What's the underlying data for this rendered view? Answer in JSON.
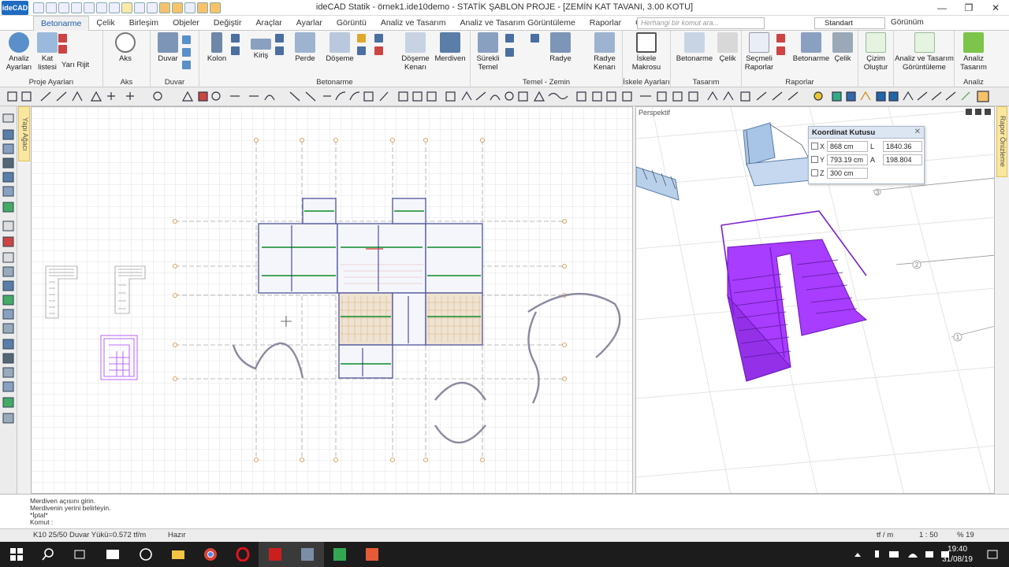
{
  "app": {
    "logo": "ideCAD",
    "title": "ideCAD Statik - örnek1.ide10demo - STATİK ŞABLON PROJE - [ZEMİN KAT TAVANI,  3.00 KOTU]",
    "window_controls": [
      "—",
      "❐",
      "✕"
    ]
  },
  "tabs": [
    "Betonarme",
    "Çelik",
    "Birleşim",
    "Objeler",
    "Değiştir",
    "Araçlar",
    "Ayarlar",
    "Görüntü",
    "Analiz ve Tasarım",
    "Analiz ve Tasarım Görüntüleme",
    "Raporlar",
    "Çizimler"
  ],
  "active_tab": "Betonarme",
  "search_placeholder": "Herhangi bir komut ara...",
  "style_select": "Standart",
  "gorunum_label": "Görünüm",
  "ribbon_groups": [
    {
      "label": "Proje Ayarları",
      "buttons": [
        "Analiz\nAyarları",
        "Kat\nlistesi",
        "Yarı Rijit"
      ]
    },
    {
      "label": "Aks",
      "buttons": [
        "Aks"
      ]
    },
    {
      "label": "Duvar",
      "buttons": [
        "Duvar"
      ]
    },
    {
      "label": "Betonarme",
      "buttons": [
        "Kolon",
        "Kiriş",
        "Perde",
        "Döşeme",
        "Döşeme\nKenarı",
        "Merdiven"
      ]
    },
    {
      "label": "Temel - Zemin",
      "buttons": [
        "Sürekli\nTemel",
        "Radye",
        "Radye\nKenarı"
      ]
    },
    {
      "label": "İskele Ayarları",
      "buttons": [
        "İskele\nMakrosu"
      ]
    },
    {
      "label": "Tasarım",
      "buttons": [
        "Betonarme",
        "Çelik"
      ]
    },
    {
      "label": "Raporlar",
      "buttons": [
        "Seçmeli\nRaporlar",
        "Betonarme",
        "Çelik"
      ]
    },
    {
      "label": "",
      "buttons": [
        "Çizim\nOluştur"
      ]
    },
    {
      "label": "",
      "buttons": [
        "Analiz ve Tasarım\nGörüntüleme"
      ]
    },
    {
      "label": "Analiz",
      "buttons": [
        "Analiz\nTasarım"
      ]
    }
  ],
  "side_tabs": {
    "left": "Yapı Ağacı",
    "right": "Rapor Önizleme"
  },
  "perspective_label": "Perspektif",
  "coord_box": {
    "title": "Koordinat Kutusu",
    "x": "868 cm",
    "y": "793.19 cm",
    "z": "300 cm",
    "l_label": "L",
    "l": "1840.36 cm",
    "a_label": "A",
    "a": "198.804"
  },
  "command_lines": [
    "Merdiven açısını girin.",
    "Merdivenin yerini belirleyin.",
    "*İptal*",
    "Komut :"
  ],
  "status": {
    "left": "K10 25/50 Duvar Yükü=0.572 tf/m",
    "state": "Hazır",
    "unit": "tf / m",
    "scale": "1 : 50",
    "zoom": "% 19"
  },
  "clock": {
    "time": "19:40",
    "date": "31/08/19"
  },
  "axis_labels": [
    "3",
    "2",
    "1"
  ],
  "colors": {
    "accent": "#1e5aa8",
    "stair": "#a83cff",
    "slab": "#e9c9a4",
    "beam_green": "#0b8a2a",
    "taskbar": "#1c1c1c"
  }
}
